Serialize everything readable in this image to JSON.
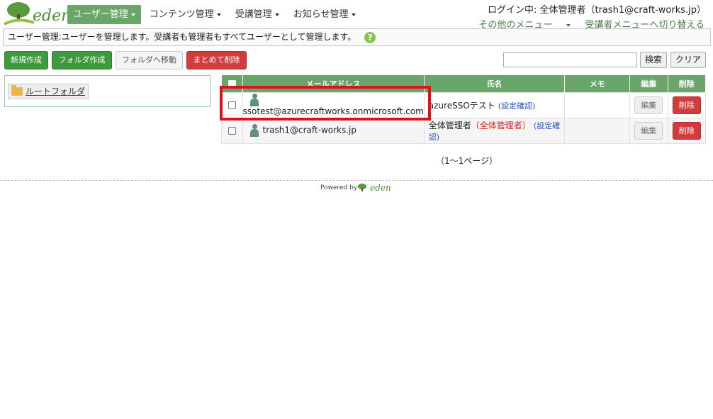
{
  "header": {
    "logo_text": "eden",
    "nav": [
      {
        "label": "ユーザー管理"
      },
      {
        "label": "コンテンツ管理"
      },
      {
        "label": "受講管理"
      },
      {
        "label": "お知らせ管理"
      }
    ],
    "login_info": "ログイン中: 全体管理者（trash1@craft-works.jp）",
    "other_menu": "その他のメニュー",
    "switch_menu": "受講者メニューへ切り替える"
  },
  "info_bar": {
    "text": "ユーザー管理:ユーザーを管理します。受講者も管理者もすべてユーザーとして管理します。",
    "help_icon": "?"
  },
  "toolbar": {
    "new_label": "新規作成",
    "new_folder_label": "フォルダ作成",
    "move_label": "フォルダへ移動",
    "bulk_delete_label": "まとめて削除",
    "search_value": "",
    "search_label": "検索",
    "clear_label": "クリア"
  },
  "folder": {
    "root_label": "ルートフォルダ"
  },
  "table": {
    "headers": {
      "email": "メールアドレス",
      "name": "氏名",
      "memo": "メモ",
      "edit": "編集",
      "delete": "削除"
    },
    "rows": [
      {
        "email": "ssotest@azurecraftworks.onmicrosoft.com",
        "name": "azureSSOテスト",
        "role": "",
        "confirm": "(設定確認)",
        "memo": "",
        "edit": "編集",
        "delete": "削除"
      },
      {
        "email": "trash1@craft-works.jp",
        "name": "全体管理者",
        "role": "（全体管理者）",
        "confirm": "(設定確認)",
        "memo": "",
        "edit": "編集",
        "delete": "削除"
      }
    ]
  },
  "pagination": "（1～1ページ）",
  "footer": {
    "powered_by": "Powered by",
    "logo_text": "eden"
  },
  "colors": {
    "brand_green": "#6aa56a",
    "danger_red": "#d23c3c",
    "highlight_red": "#e0111c"
  }
}
